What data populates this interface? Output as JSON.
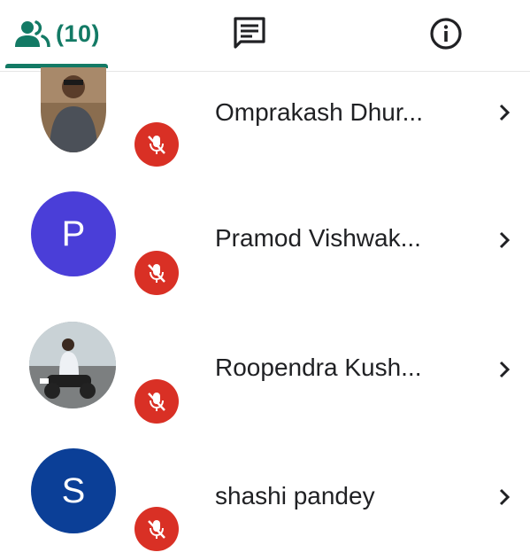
{
  "tabs": {
    "people": {
      "count_label": "(10)",
      "icon": "people-icon"
    },
    "chat": {
      "icon": "chat-icon"
    },
    "info": {
      "icon": "info-icon"
    }
  },
  "participants": [
    {
      "name": "Omprakash Dhur...",
      "avatar_type": "photo",
      "muted": true
    },
    {
      "name": "Pramod Vishwak...",
      "avatar_type": "letter",
      "avatar_letter": "P",
      "avatar_color": "#4a3ed8",
      "muted": true
    },
    {
      "name": "Roopendra Kush...",
      "avatar_type": "photo",
      "muted": true
    },
    {
      "name": "shashi pandey",
      "avatar_type": "letter",
      "avatar_letter": "S",
      "avatar_color": "#0b3f97",
      "muted": true
    }
  ],
  "colors": {
    "accent": "#137a65",
    "mute_badge": "#d93025"
  }
}
